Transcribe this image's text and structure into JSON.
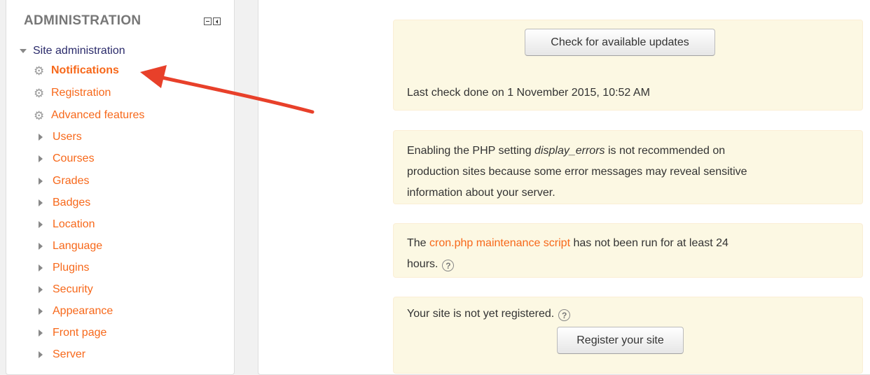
{
  "sidebar": {
    "title": "ADMINISTRATION",
    "root_label": "Site administration",
    "items": [
      {
        "label": "Notifications",
        "icon": "gear-icon"
      },
      {
        "label": "Registration",
        "icon": "gear-icon"
      },
      {
        "label": "Advanced features",
        "icon": "gear-icon"
      },
      {
        "label": "Users"
      },
      {
        "label": "Courses"
      },
      {
        "label": "Grades"
      },
      {
        "label": "Badges"
      },
      {
        "label": "Location"
      },
      {
        "label": "Language"
      },
      {
        "label": "Plugins"
      },
      {
        "label": "Security"
      },
      {
        "label": "Appearance"
      },
      {
        "label": "Front page"
      },
      {
        "label": "Server"
      }
    ]
  },
  "main": {
    "updates_button": "Check for available updates",
    "last_check": "Last check done on 1 November 2015, 10:52 AM",
    "display_errors_pre": "Enabling the PHP setting ",
    "display_errors_em": "display_errors",
    "display_errors_line1_post": " is not recommended on",
    "display_errors_line2": "production sites because some error messages may reveal sensitive",
    "display_errors_line3": "information about your server.",
    "cron_pre": "The ",
    "cron_link": "cron.php maintenance script",
    "cron_post": " has not been run for at least 24",
    "cron_line2": "hours.",
    "registration_text": "Your site is not yet registered.",
    "register_button": "Register your site",
    "help_glyph": "?"
  },
  "colors": {
    "link": "#f7681a",
    "notice_bg": "#fcf8e3",
    "arrow": "#e8402a"
  }
}
